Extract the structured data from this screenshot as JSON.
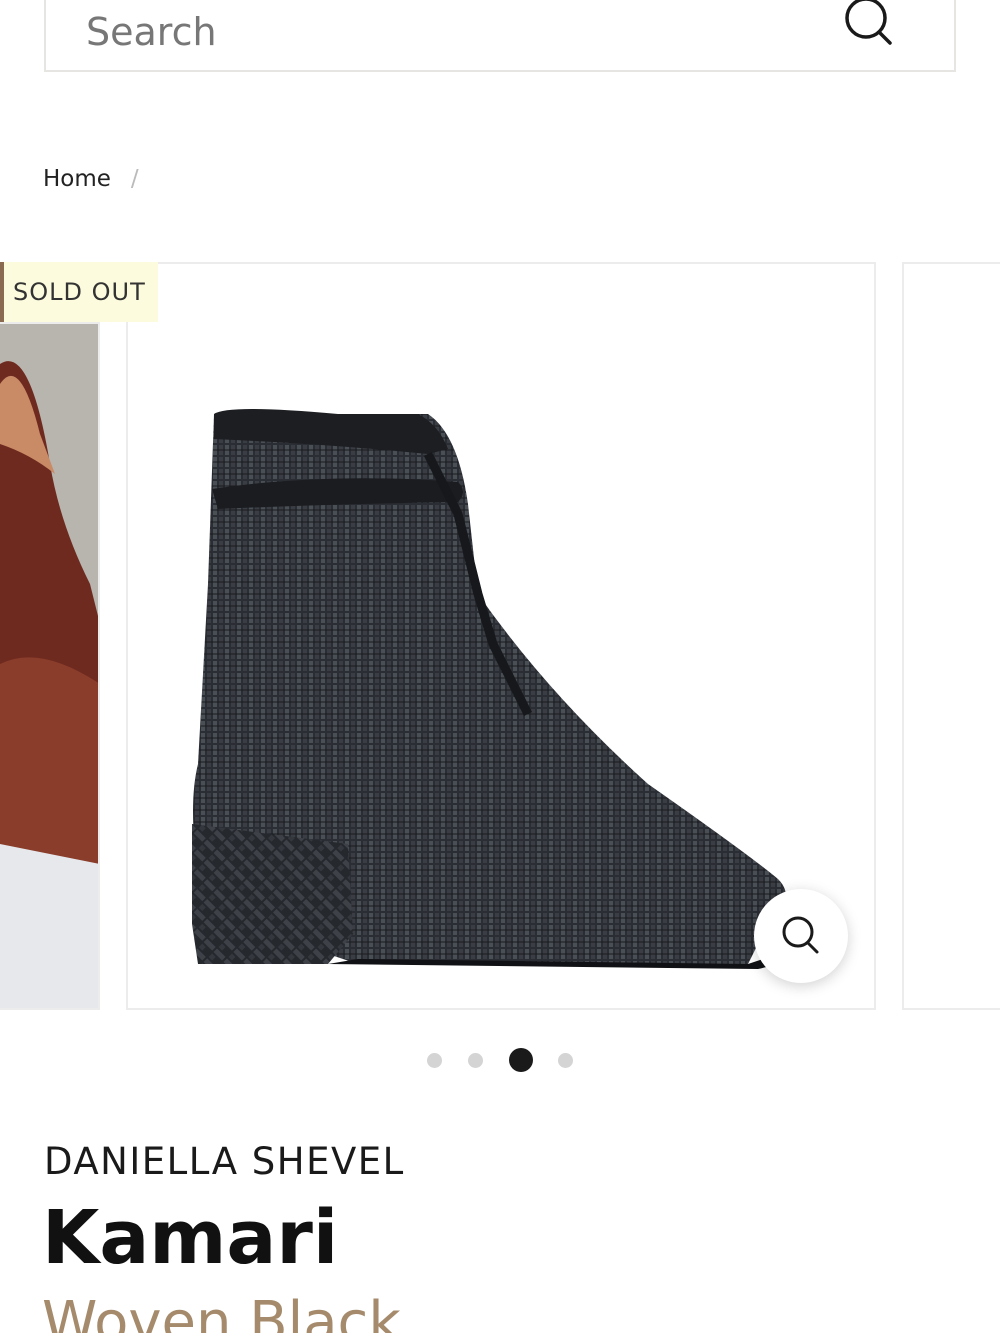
{
  "search": {
    "placeholder": "Search"
  },
  "breadcrumb": {
    "home": "Home",
    "separator": "/"
  },
  "product": {
    "badge": "SOLD OUT",
    "brand": "DANIELLA SHEVEL",
    "name": "Kamari",
    "variant": "Woven Black"
  },
  "gallery": {
    "image_count": 4,
    "active_index": 2
  },
  "colors": {
    "badge_bg": "#fdfbdd",
    "badge_border": "#8a6b52",
    "variant_text": "#a58b6c",
    "dot_active": "#1a1a1a",
    "dot_inactive": "#d4d4d4"
  },
  "icons": {
    "search": "search-icon",
    "zoom": "zoom-icon"
  }
}
